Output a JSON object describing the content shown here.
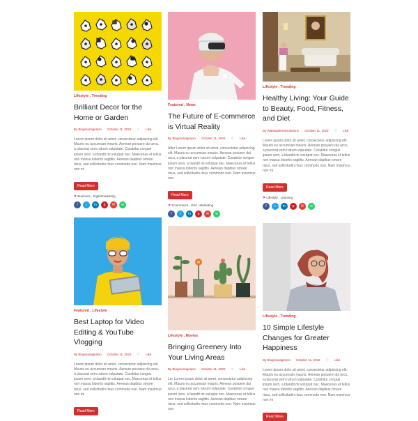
{
  "posts": [
    {
      "categories": "Lifestyle , Trending",
      "title": "Brilliant Decor for the Home or Garden",
      "author": "By Blogmanagerpro",
      "date": "October 11, 2022",
      "like": "Like",
      "comments": "0",
      "excerpt": "Lorem ipsum dolor sit amet, consectetur adipiscing elit. Mauris eu accumsan mauris. Aenean posuere dui arcu, a placerat sem rutrum vulputate. Curabitur congue ipsum sem, a blandit mi volutpat nec. Maecenas et tellus non massa lobortis sagittis. Aenean dapibus ornare risus, sed sollicitudin risus commodo non. Nam maximus non mi",
      "read_more": "Read More",
      "tags": "Business , Digitalmarketing"
    },
    {
      "categories": "Featured , News",
      "title": "The Future of E-commerce is Virtual Reality",
      "author": "By Blogmanagerpro",
      "date": "October 11, 2022",
      "like": "Like",
      "comments": "0",
      "excerpt": "After Lorem ipsum dolor sit amet, consectetur adipiscing elit. Mauris eu accumsan mauris. Aenean posuere dui arcu, a placerat sem rutrum vulputate. Curabitur congue ipsum sem, a blandit mi volutpat nec. Maecenas et tellus non massa lobortis sagittis. Aenean dapibus ornare risus, sed sollicitudin risus commodo non. Nam maximus non",
      "read_more": "Read More",
      "tags": "Ecommerce , Grid , Marketing"
    },
    {
      "categories": "Lifestyle , Trending",
      "title": "Healthy Living: Your Guide to Beauty, Food, Fitness, and Diet",
      "author": "By Wablogthemesolutions",
      "date": "October 11, 2022",
      "like": "Like",
      "comments": "0",
      "excerpt": "Lorem ipsum dolor sit amet, consectetur adipiscing elit. Mauris eu accumsan mauris. Aenean posuere dui arcu, a placerat sem rutrum vulputate. Curabitur congue ipsum sem, a blandit mi volutpat nec. Maecenas et tellus non massa lobortis sagittis. Aenean dapibus ornare risus, sed sollicitudin risus commodo non. Nam maximus non mi",
      "read_more": "Read More",
      "tags": "Lifestyle , Learning"
    },
    {
      "categories": "Featured , Lifestyle",
      "title": "Best Laptop for Video Editing & YouTube Vlogging",
      "author": "By Blogmanagerpro",
      "date": "October 11, 2022",
      "like": "Like",
      "comments": "0",
      "excerpt": "Lorem ipsum dolor sit amet, consectetur adipiscing elit. Mauris eu accumsan mauris. Aenean posuere dui arcu, a placerat sem rutrum vulputate. Curabitur congue ipsum sem, a blandit mi volutpat nec. Maecenas et tellus non massa lobortis sagittis. Aenean dapibus ornare risus, sed sollicitudin risus commodo non. Nam maximus non mi",
      "read_more": "Read More"
    },
    {
      "categories": "Lifestyle , Movies",
      "title": "Bringing Greenery Into Your Living Areas",
      "author": "By Blogmanagerpro",
      "date": "October 11, 2022",
      "like": "Like",
      "comments": "0",
      "excerpt": "Lor Lorem ipsum dolor sit amet, consectetur adipiscing elit. Mauris eu accumsan mauris. Aenean posuere dui arcu, a placerat sem rutrum vulputate. Curabitur congue ipsum sem, a blandit mi volutpat nec. Maecenas et tellus non massa lobortis sagittis. Aenean dapibus ornare risus, sed sollicitudin risus commodo non. Nam maximus non"
    },
    {
      "categories": "Lifestyle , Trending",
      "title": "10 Simple Lifestyle Changes for Greater Happiness",
      "author": "By Blogmanagerpro",
      "date": "October 11, 2022",
      "like": "Like",
      "comments": "0",
      "excerpt": "Lorem ipsum dolor sit amet, consectetur adipiscing elit. Mauris eu accumsan mauris. Aenean posuere dui arcu, a placerat sem rutrum vulputate. Curabitur congue ipsum sem, a blandit mi volutpat nec. Maecenas et tellus non massa lobortis sagittis. Aenean dapibus ornare risus, sed sollicitudin risus commodo non. Nam maximus non mi",
      "read_more": "Read More"
    }
  ],
  "share_icons": [
    "facebook-icon",
    "twitter-icon",
    "linkedin-icon",
    "pinterest-icon",
    "email-icon",
    "whatsapp-icon"
  ],
  "colors": {
    "accent": "#d32f2f",
    "text": "#1d1d1d",
    "muted": "#6a6a6a"
  }
}
